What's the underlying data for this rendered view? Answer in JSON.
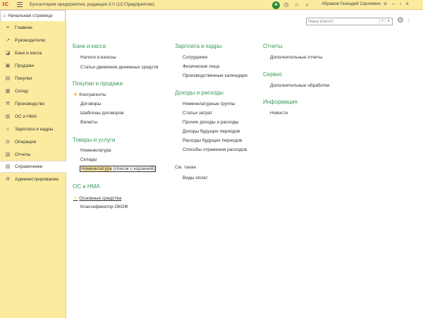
{
  "titlebar": {
    "logo": "1С",
    "title": "Бухгалтерия предприятия, редакция 3.0  (1С:Предприятие)",
    "user": "Абрамов Геннадий Сергеевич",
    "icons": [
      "bell-icon",
      "history-icon",
      "star-icon",
      "search-icon"
    ],
    "window_buttons": [
      "minimize",
      "maximize",
      "close"
    ]
  },
  "tab": {
    "home_label": "Начальная страница"
  },
  "sidebar": {
    "items": [
      {
        "label": "Главное",
        "icon": "menu-icon"
      },
      {
        "label": "Руководителю",
        "icon": "chart-icon"
      },
      {
        "label": "Банк и касса",
        "icon": "bank-icon"
      },
      {
        "label": "Продажи",
        "icon": "sales-icon"
      },
      {
        "label": "Покупки",
        "icon": "cart-icon"
      },
      {
        "label": "Склад",
        "icon": "warehouse-icon"
      },
      {
        "label": "Производство",
        "icon": "factory-icon"
      },
      {
        "label": "ОС и НМА",
        "icon": "assets-icon"
      },
      {
        "label": "Зарплата и кадры",
        "icon": "people-icon"
      },
      {
        "label": "Операции",
        "icon": "operations-icon"
      },
      {
        "label": "Отчеты",
        "icon": "reports-icon"
      },
      {
        "label": "Справочники",
        "icon": "book-icon"
      },
      {
        "label": "Администрирование",
        "icon": "gear-icon"
      }
    ],
    "active_index": 11
  },
  "search": {
    "placeholder": "Поиск (Ctrl+F)",
    "clear": "×",
    "dropdown": "▾"
  },
  "settings": {
    "more": "⋮"
  },
  "col1": {
    "bank": {
      "title": "Банк и касса",
      "links": [
        "Налоги и взносы",
        "Статьи движения денежных средств"
      ]
    },
    "sales": {
      "title": "Покупки и продажи",
      "links": [
        "Контрагенты",
        "Договоры",
        "Шаблоны договоров",
        "Валюты"
      ]
    },
    "goods": {
      "title": "Товары и услуги",
      "links": [
        "Номенклатура",
        "Склады"
      ],
      "focused_link": "Номенклатура",
      "focused_rest": " (список с корзиной)"
    },
    "os": {
      "title": "ОС и НМА",
      "links": [
        "Основные средства",
        "Классификатор ОКОФ"
      ]
    }
  },
  "col2": {
    "salary": {
      "title": "Зарплата и кадры",
      "links": [
        "Сотрудники",
        "Физические лица",
        "Производственные календари"
      ]
    },
    "income": {
      "title": "Доходы и расходы",
      "links": [
        "Номенклатурные группы",
        "Статьи затрат",
        "Прочие доходы и расходы",
        "Доходы будущих периодов",
        "Расходы будущих периодов",
        "Способы отражения расходов"
      ]
    },
    "see_also": {
      "title": "См. также",
      "links": [
        "Виды оплат"
      ]
    }
  },
  "col3": {
    "reports": {
      "title": "Отчеты",
      "links": [
        "Дополнительные отчеты"
      ]
    },
    "service": {
      "title": "Сервис",
      "links": [
        "Дополнительные обработки"
      ]
    },
    "info": {
      "title": "Информация",
      "links": [
        "Новости"
      ]
    }
  },
  "colors": {
    "accent_green": "#3a9a58",
    "panel_yellow": "#fbeb9f",
    "star": "#f2b000"
  }
}
